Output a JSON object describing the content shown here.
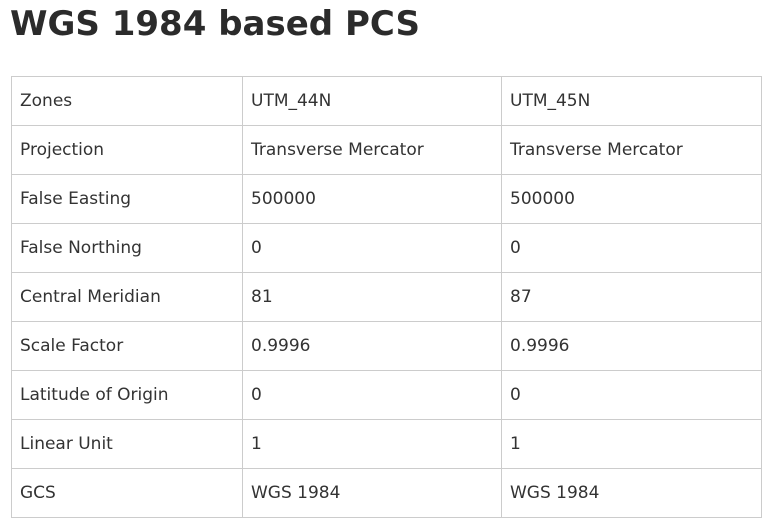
{
  "title": "WGS 1984 based PCS",
  "table": {
    "rows": [
      {
        "label": "Zones",
        "a": "UTM_44N",
        "b": "UTM_45N"
      },
      {
        "label": "Projection",
        "a": "Transverse Mercator",
        "b": "Transverse Mercator"
      },
      {
        "label": "False Easting",
        "a": "500000",
        "b": "500000"
      },
      {
        "label": "False Northing",
        "a": "0",
        "b": "0"
      },
      {
        "label": "Central Meridian",
        "a": "81",
        "b": "87"
      },
      {
        "label": "Scale Factor",
        "a": "0.9996",
        "b": "0.9996"
      },
      {
        "label": "Latitude of Origin",
        "a": "0",
        "b": "0"
      },
      {
        "label": "Linear Unit",
        "a": "1",
        "b": "1"
      },
      {
        "label": "GCS",
        "a": "WGS 1984",
        "b": "WGS 1984"
      }
    ]
  }
}
